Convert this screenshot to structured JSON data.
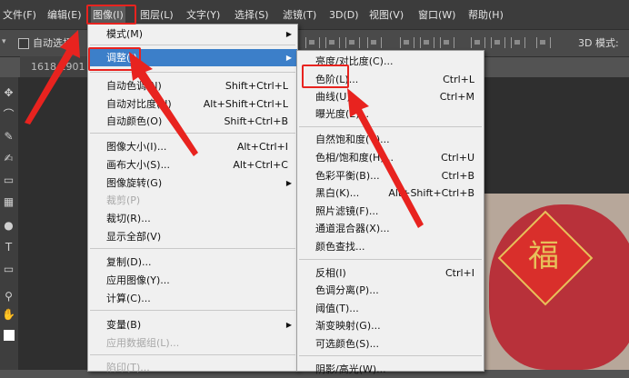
{
  "menubar": {
    "items": [
      "文件(F)",
      "编辑(E)",
      "图像(I)",
      "图层(L)",
      "文字(Y)",
      "选择(S)",
      "滤镜(T)",
      "3D(D)",
      "视图(V)",
      "窗口(W)",
      "帮助(H)"
    ]
  },
  "options": {
    "auto_select": "自动选择",
    "mode_3d": "3D 模式:"
  },
  "document": {
    "tab": "1618 1901"
  },
  "image_menu": [
    {
      "label": "模式(M)"
    },
    {
      "label": "调整(J)"
    },
    {
      "label": "自动色调(N)",
      "shortcut": "Shift+Ctrl+L"
    },
    {
      "label": "自动对比度(U)",
      "shortcut": "Alt+Shift+Ctrl+L"
    },
    {
      "label": "自动颜色(O)",
      "shortcut": "Shift+Ctrl+B"
    },
    {
      "label": "图像大小(I)...",
      "shortcut": "Alt+Ctrl+I"
    },
    {
      "label": "画布大小(S)...",
      "shortcut": "Alt+Ctrl+C"
    },
    {
      "label": "图像旋转(G)"
    },
    {
      "label": "裁剪(P)"
    },
    {
      "label": "裁切(R)..."
    },
    {
      "label": "显示全部(V)"
    },
    {
      "label": "复制(D)..."
    },
    {
      "label": "应用图像(Y)..."
    },
    {
      "label": "计算(C)..."
    },
    {
      "label": "变量(B)"
    },
    {
      "label": "应用数据组(L)..."
    },
    {
      "label": "陷印(T)..."
    }
  ],
  "adjust_menu": [
    {
      "label": "亮度/对比度(C)..."
    },
    {
      "label": "色阶(L)...",
      "shortcut": "Ctrl+L"
    },
    {
      "label": "曲线(U)...",
      "shortcut": "Ctrl+M"
    },
    {
      "label": "曝光度(E)..."
    },
    {
      "label": "自然饱和度(V)..."
    },
    {
      "label": "色相/饱和度(H)...",
      "shortcut": "Ctrl+U"
    },
    {
      "label": "色彩平衡(B)...",
      "shortcut": "Ctrl+B"
    },
    {
      "label": "黑白(K)...",
      "shortcut": "Alt+Shift+Ctrl+B"
    },
    {
      "label": "照片滤镜(F)..."
    },
    {
      "label": "通道混合器(X)..."
    },
    {
      "label": "颜色查找..."
    },
    {
      "label": "反相(I)",
      "shortcut": "Ctrl+I"
    },
    {
      "label": "色调分离(P)..."
    },
    {
      "label": "阈值(T)..."
    },
    {
      "label": "渐变映射(G)..."
    },
    {
      "label": "可选颜色(S)..."
    },
    {
      "label": "阴影/高光(W)..."
    }
  ],
  "photo": {
    "glyph": "福"
  },
  "colors": {
    "annotation": "#e8231f",
    "menu_bg": "#f0f0f0",
    "highlight": "#3c7fc9"
  }
}
